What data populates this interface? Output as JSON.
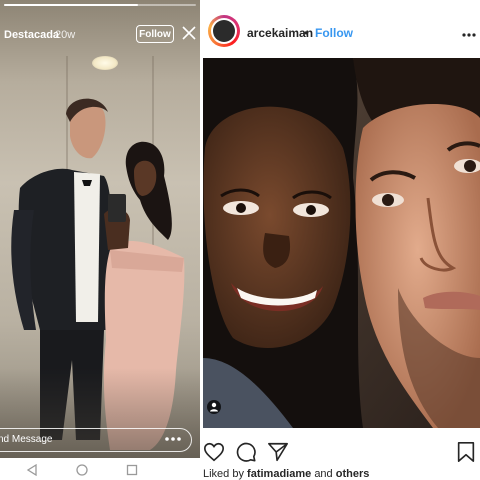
{
  "story": {
    "username": "Destacada",
    "age": "20w",
    "follow_label": "Follow",
    "progress": 0.7,
    "message_placeholder": "nd Message"
  },
  "post": {
    "username": "arcekaiman",
    "separator": "•",
    "follow_label": "Follow",
    "liked_prefix": "Liked by",
    "liked_user": "fatimadiame",
    "liked_middle": "and",
    "liked_others": "others"
  },
  "colors": {
    "link_blue": "#3897f0",
    "text_dark": "#262626",
    "ring_gradient": [
      "#c13584",
      "#e1306c",
      "#fd1d1d",
      "#f77737",
      "#fcaf45"
    ]
  },
  "icons": {
    "close": "close-icon",
    "more": "more-dots-icon",
    "options": "options-dots-icon",
    "tag": "person-tag-icon",
    "like": "heart-icon",
    "comment": "comment-icon",
    "share": "share-icon",
    "save": "bookmark-icon",
    "back": "back-triangle-icon",
    "home": "home-circle-icon",
    "recents": "recents-square-icon"
  }
}
